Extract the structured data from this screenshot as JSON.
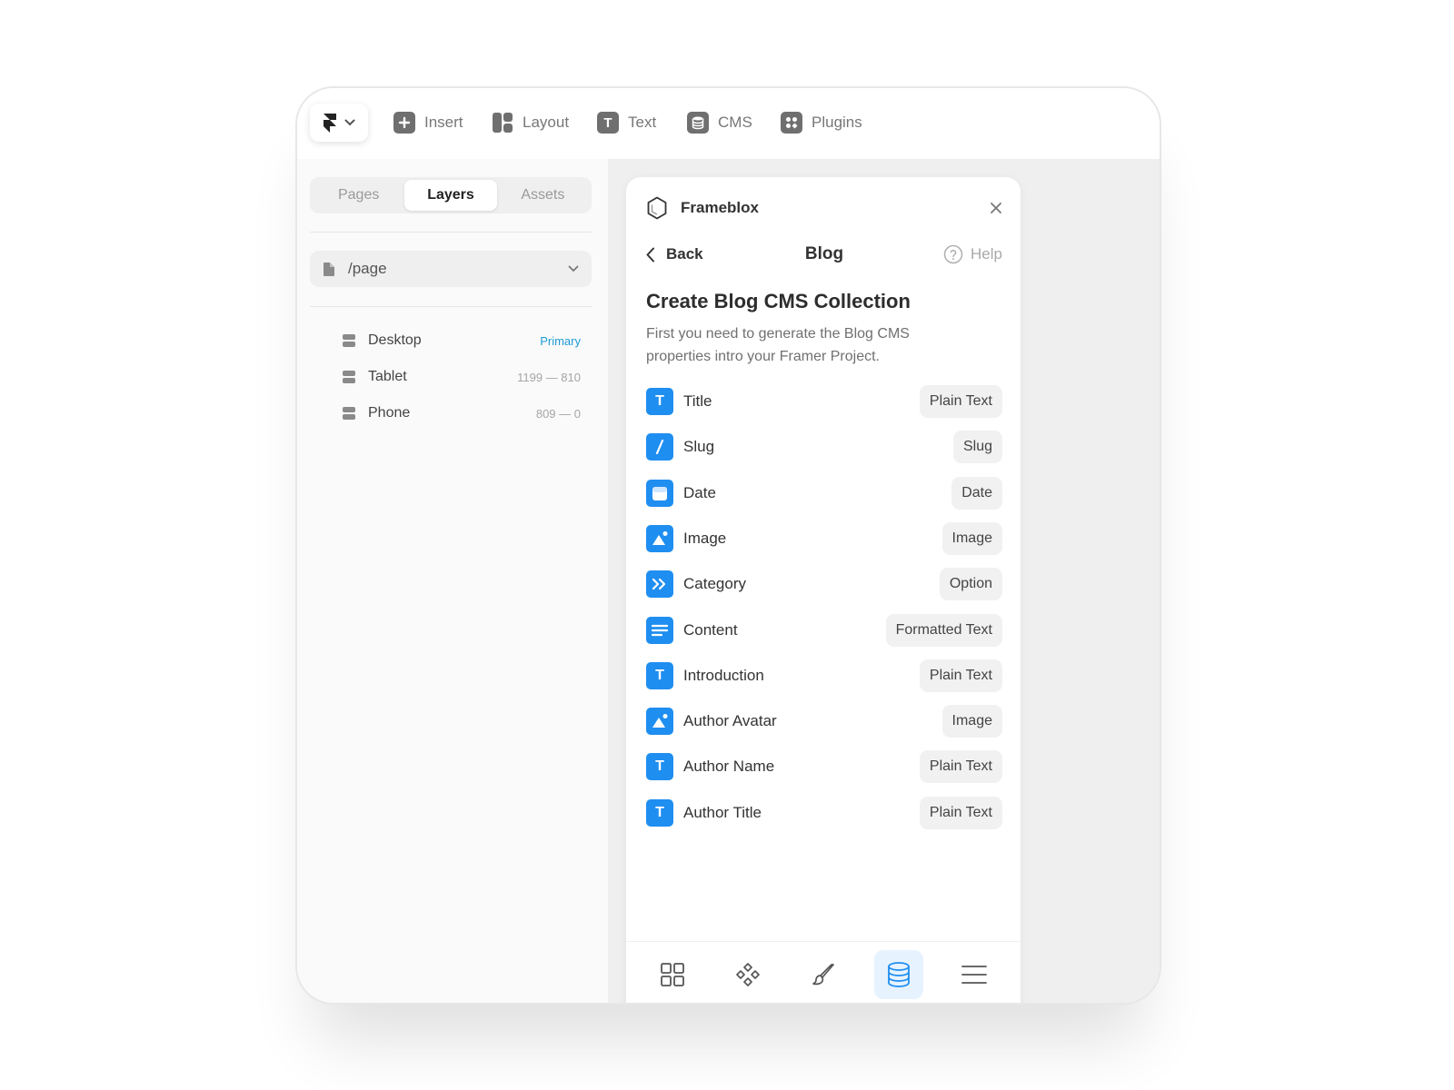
{
  "toolbar": {
    "items": [
      {
        "label": "Insert",
        "icon": "plus-icon"
      },
      {
        "label": "Layout",
        "icon": "layout-icon"
      },
      {
        "label": "Text",
        "icon": "text-icon"
      },
      {
        "label": "CMS",
        "icon": "database-icon"
      },
      {
        "label": "Plugins",
        "icon": "plugins-icon"
      }
    ]
  },
  "left_panel": {
    "tabs": [
      "Pages",
      "Layers",
      "Assets"
    ],
    "active_tab": "Layers",
    "page_select": "/page",
    "layers": [
      {
        "name": "Desktop",
        "meta": "Primary"
      },
      {
        "name": "Tablet",
        "meta": "1199 — 810"
      },
      {
        "name": "Phone",
        "meta": "809 — 0"
      }
    ]
  },
  "plugin": {
    "name": "Frameblox",
    "back_label": "Back",
    "nav_title": "Blog",
    "help_label": "Help",
    "heading": "Create Blog CMS Collection",
    "description": "First you need to generate the Blog CMS properties intro your Framer Project.",
    "fields": [
      {
        "name": "Title",
        "type": "Plain Text",
        "icon": "text-field-icon"
      },
      {
        "name": "Slug",
        "type": "Slug",
        "icon": "slug-icon"
      },
      {
        "name": "Date",
        "type": "Date",
        "icon": "date-icon"
      },
      {
        "name": "Image",
        "type": "Image",
        "icon": "image-icon"
      },
      {
        "name": "Category",
        "type": "Option",
        "icon": "option-icon"
      },
      {
        "name": "Content",
        "type": "Formatted Text",
        "icon": "formatted-text-icon"
      },
      {
        "name": "Introduction",
        "type": "Plain Text",
        "icon": "text-field-icon"
      },
      {
        "name": "Author Avatar",
        "type": "Image",
        "icon": "image-icon"
      },
      {
        "name": "Author Name",
        "type": "Plain Text",
        "icon": "text-field-icon"
      },
      {
        "name": "Author Title",
        "type": "Plain Text",
        "icon": "text-field-icon"
      }
    ],
    "bottom_nav": [
      "grid-icon",
      "components-icon",
      "brush-icon",
      "database-icon",
      "menu-icon"
    ],
    "bottom_nav_active": "database-icon"
  },
  "colors": {
    "accent": "#1f8ef1",
    "primary_badge": "#1e9bd7"
  }
}
